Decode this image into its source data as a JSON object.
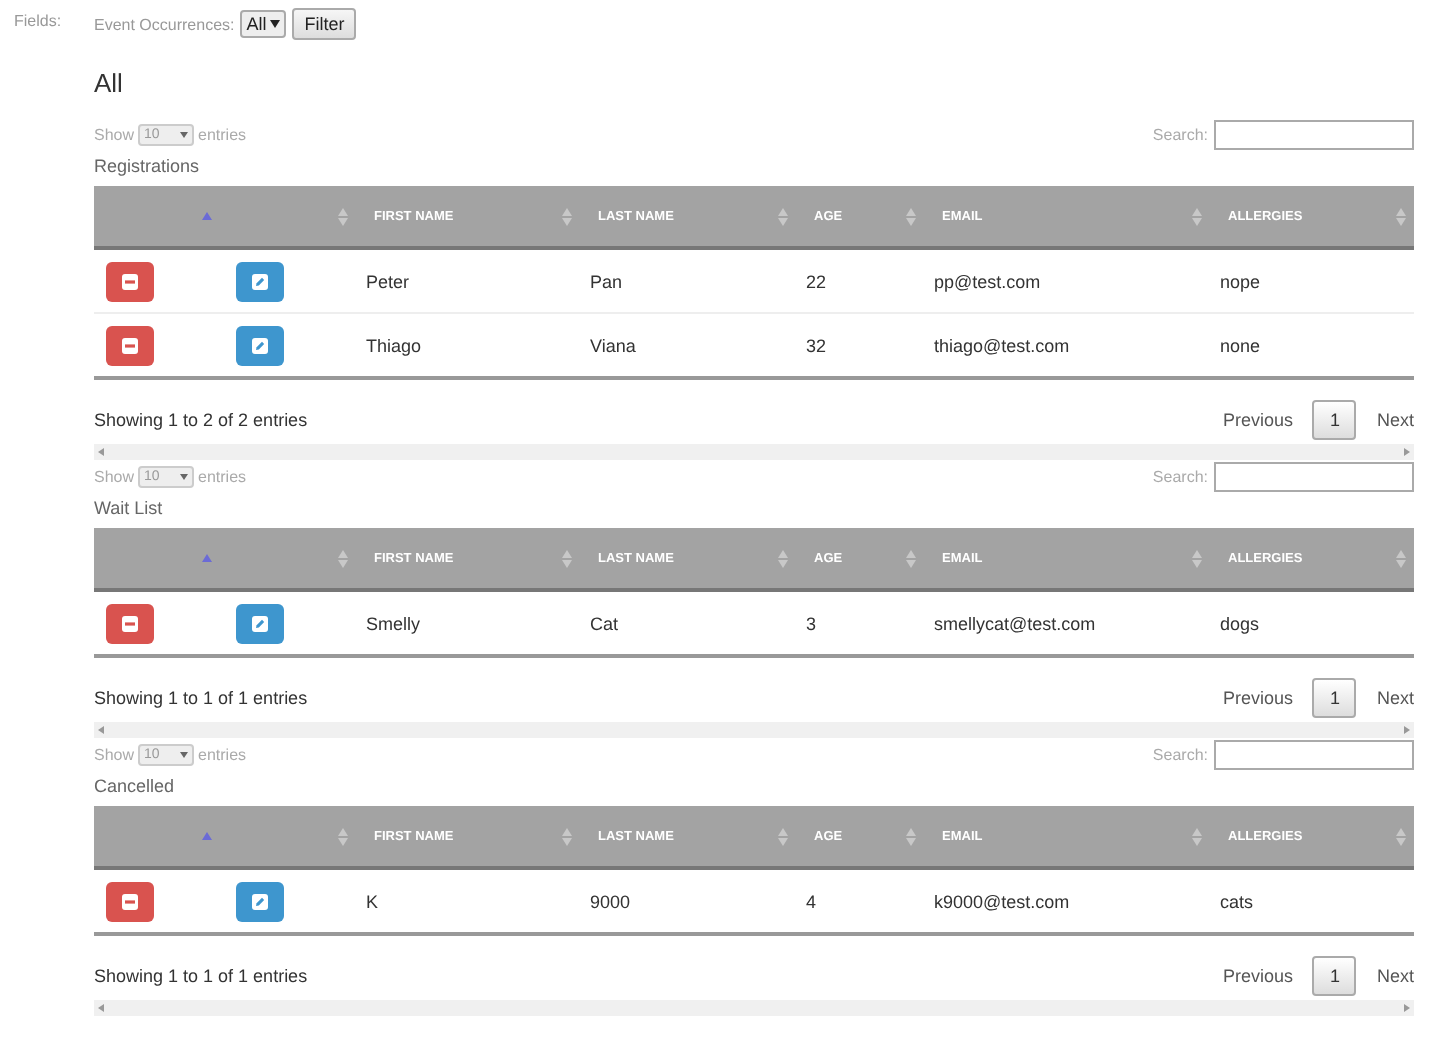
{
  "fields_label": "Fields:",
  "filter": {
    "label": "Event Occurrences:",
    "select_value": "All",
    "button": "Filter"
  },
  "heading": "All",
  "sections": [
    {
      "length": {
        "before": "Show",
        "value": "10",
        "after": "entries"
      },
      "search_label": "Search:",
      "title": "Registrations",
      "columns": [
        {
          "sorted": true
        },
        {
          "sorted": false
        },
        {
          "label": "FIRST NAME",
          "sorted": false
        },
        {
          "label": "LAST NAME",
          "sorted": false
        },
        {
          "label": "AGE",
          "sorted": false
        },
        {
          "label": "EMAIL",
          "sorted": false
        },
        {
          "label": "ALLERGIES",
          "sorted": false
        }
      ],
      "rows": [
        {
          "cells": [
            {
              "kind": "delete"
            },
            {
              "kind": "edit"
            },
            {
              "kind": "text",
              "text": "Peter"
            },
            {
              "kind": "text",
              "text": "Pan"
            },
            {
              "kind": "text",
              "text": "22"
            },
            {
              "kind": "text",
              "text": "pp@test.com"
            },
            {
              "kind": "text",
              "text": "nope"
            }
          ]
        },
        {
          "cells": [
            {
              "kind": "delete"
            },
            {
              "kind": "edit"
            },
            {
              "kind": "text",
              "text": "Thiago"
            },
            {
              "kind": "text",
              "text": "Viana"
            },
            {
              "kind": "text",
              "text": "32"
            },
            {
              "kind": "text",
              "text": "thiago@test.com"
            },
            {
              "kind": "text",
              "text": "none"
            }
          ]
        }
      ],
      "info": "Showing 1 to 2 of 2 entries",
      "pagination": {
        "previous": "Previous",
        "pages": [
          {
            "label": "1",
            "selected": true
          }
        ],
        "next": "Next"
      }
    },
    {
      "length": {
        "before": "Show",
        "value": "10",
        "after": "entries"
      },
      "search_label": "Search:",
      "title": "Wait List",
      "columns": [
        {
          "sorted": true
        },
        {
          "sorted": false
        },
        {
          "label": "FIRST NAME",
          "sorted": false
        },
        {
          "label": "LAST NAME",
          "sorted": false
        },
        {
          "label": "AGE",
          "sorted": false
        },
        {
          "label": "EMAIL",
          "sorted": false
        },
        {
          "label": "ALLERGIES",
          "sorted": false
        }
      ],
      "rows": [
        {
          "cells": [
            {
              "kind": "delete"
            },
            {
              "kind": "edit"
            },
            {
              "kind": "text",
              "text": "Smelly"
            },
            {
              "kind": "text",
              "text": "Cat"
            },
            {
              "kind": "text",
              "text": "3"
            },
            {
              "kind": "text",
              "text": "smellycat@test.com"
            },
            {
              "kind": "text",
              "text": "dogs"
            }
          ]
        }
      ],
      "info": "Showing 1 to 1 of 1 entries",
      "pagination": {
        "previous": "Previous",
        "pages": [
          {
            "label": "1",
            "selected": true
          }
        ],
        "next": "Next"
      }
    },
    {
      "length": {
        "before": "Show",
        "value": "10",
        "after": "entries"
      },
      "search_label": "Search:",
      "title": "Cancelled",
      "columns": [
        {
          "sorted": true
        },
        {
          "sorted": false
        },
        {
          "label": "FIRST NAME",
          "sorted": false
        },
        {
          "label": "LAST NAME",
          "sorted": false
        },
        {
          "label": "AGE",
          "sorted": false
        },
        {
          "label": "EMAIL",
          "sorted": false
        },
        {
          "label": "ALLERGIES",
          "sorted": false
        }
      ],
      "rows": [
        {
          "cells": [
            {
              "kind": "delete"
            },
            {
              "kind": "edit"
            },
            {
              "kind": "text",
              "text": "K"
            },
            {
              "kind": "text",
              "text": "9000"
            },
            {
              "kind": "text",
              "text": "4"
            },
            {
              "kind": "text",
              "text": "k9000@test.com"
            },
            {
              "kind": "text",
              "text": "cats"
            }
          ]
        }
      ],
      "info": "Showing 1 to 1 of 1 entries",
      "pagination": {
        "previous": "Previous",
        "pages": [
          {
            "label": "1",
            "selected": true
          }
        ],
        "next": "Next"
      }
    }
  ]
}
